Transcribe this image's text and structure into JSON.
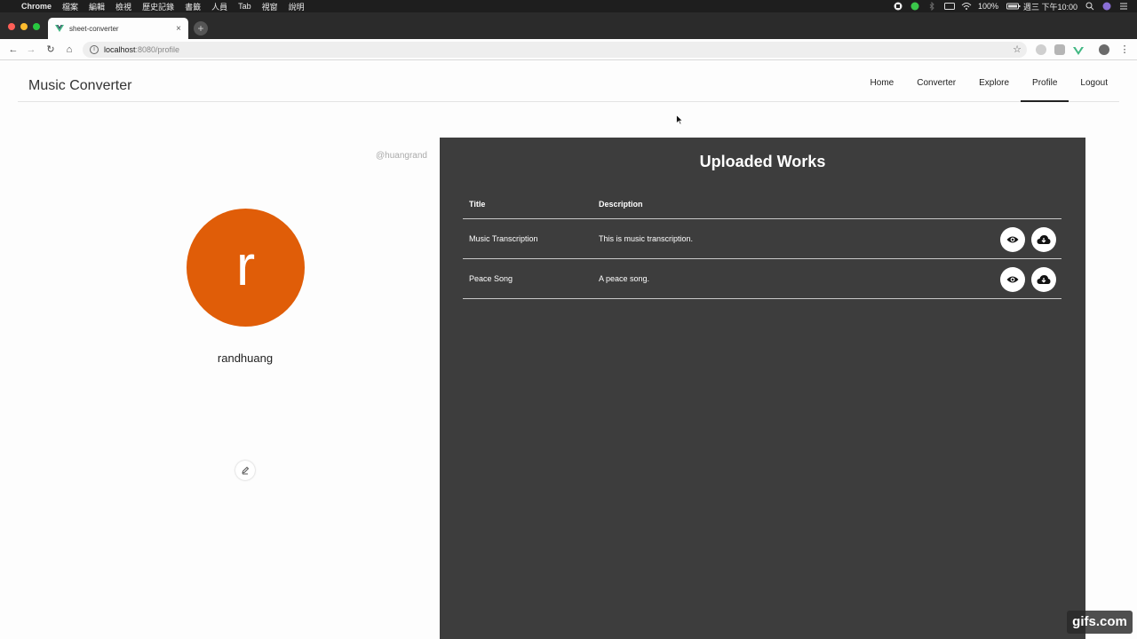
{
  "menubar": {
    "app": "Chrome",
    "items": [
      "檔案",
      "編輯",
      "檢視",
      "歷史記錄",
      "書籤",
      "人員",
      "Tab",
      "視窗",
      "說明"
    ],
    "battery": "100%",
    "clock": "週三 下午10:00"
  },
  "browser": {
    "tab_title": "sheet-converter",
    "tab_close": "×",
    "new_tab": "+",
    "url_host": "localhost",
    "url_path": ":8080/profile"
  },
  "navbar": {
    "brand": "Music Converter",
    "links": [
      {
        "label": "Home"
      },
      {
        "label": "Converter"
      },
      {
        "label": "Explore"
      },
      {
        "label": "Profile"
      },
      {
        "label": "Logout"
      }
    ],
    "active": "Profile"
  },
  "profile": {
    "handle": "@huangrand",
    "avatar_letter": "r",
    "avatar_color": "#e05d08",
    "username": "randhuang"
  },
  "works": {
    "heading": "Uploaded Works",
    "columns": [
      "Title",
      "Description"
    ],
    "rows": [
      {
        "title": "Music Transcription",
        "description": "This is music transcription."
      },
      {
        "title": "Peace Song",
        "description": "A peace song."
      }
    ]
  },
  "watermark": "gifs.com"
}
